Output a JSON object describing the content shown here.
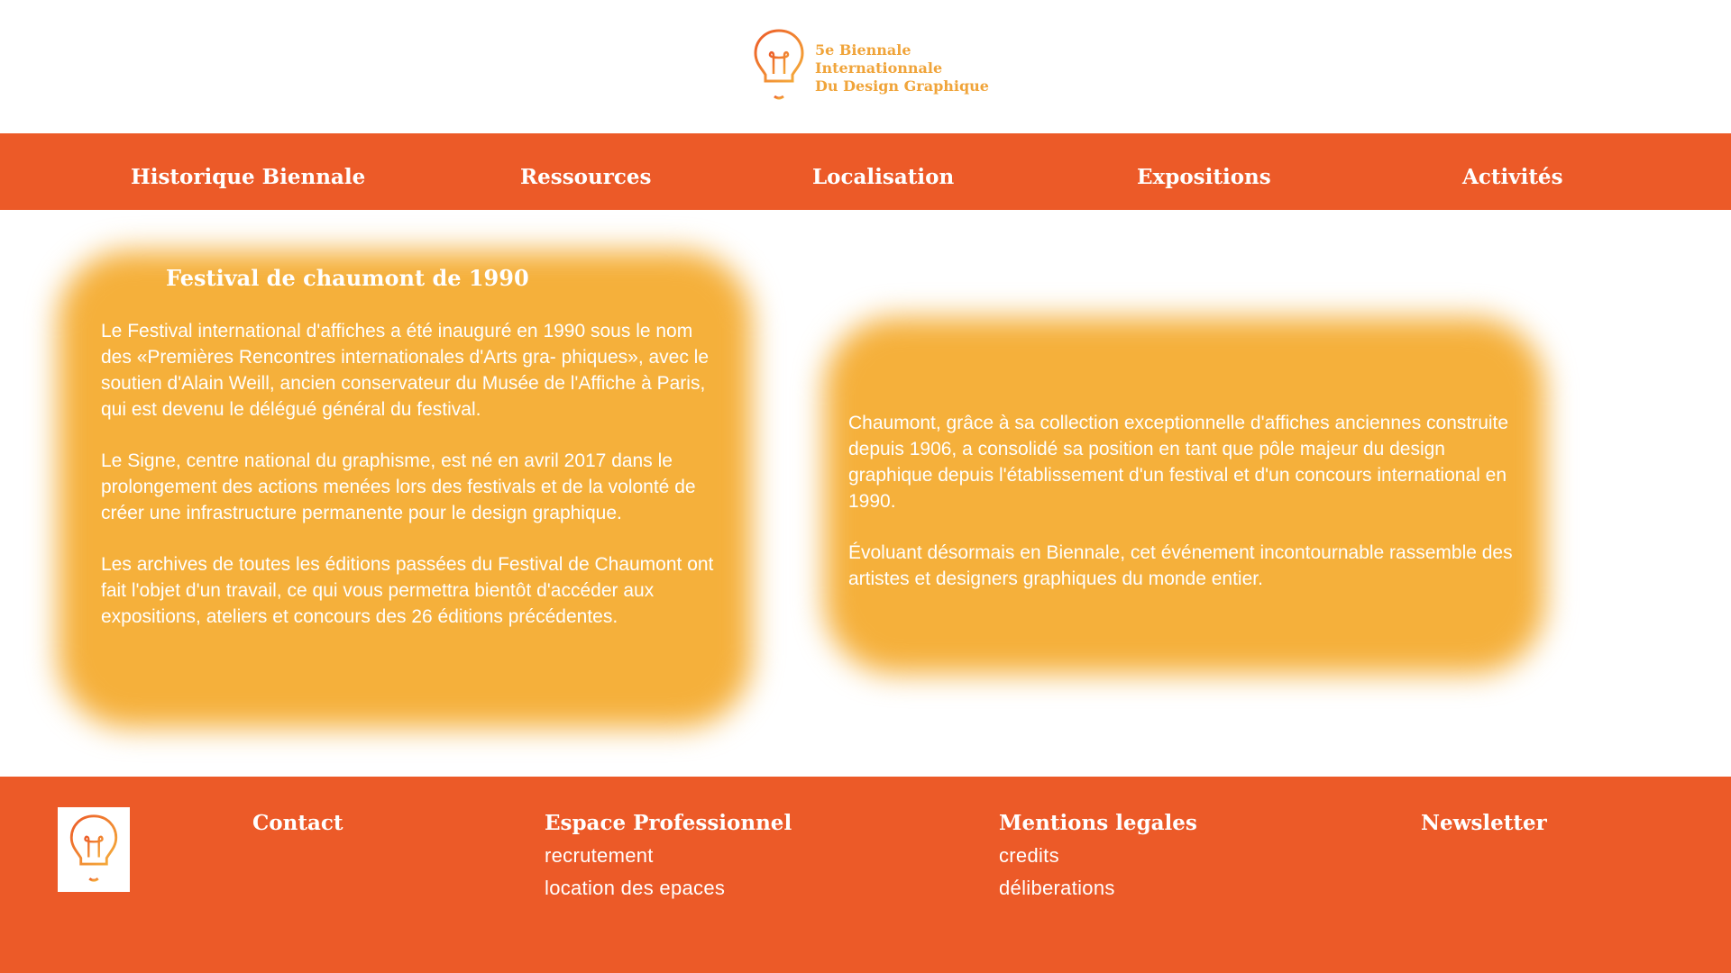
{
  "header": {
    "logo_lines": [
      "5e Biennale",
      "Internationnale",
      "Du Design Graphique"
    ],
    "logo_icon": "lightbulb-icon"
  },
  "nav": {
    "items": [
      {
        "label": "Historique Biennale"
      },
      {
        "label": "Ressources"
      },
      {
        "label": "Localisation"
      },
      {
        "label": "Expositions"
      },
      {
        "label": "Activités"
      }
    ]
  },
  "main": {
    "left_card": {
      "title": "Festival de chaumont de 1990",
      "paragraphs": [
        "Le Festival international d'affiches a été inauguré en 1990 sous le nom des «Premières Rencontres internationales d'Arts gra- phiques», avec le soutien d'Alain Weill, ancien conservateur du Musée de l'Affiche à Paris, qui est devenu le délégué général du festival.",
        "Le Signe, centre national du graphisme, est né en avril 2017 dans le prolongement des actions menées lors des festivals et de la volonté de créer une infrastructure permanente pour le design graphique.",
        "Les archives de toutes les éditions passées du Festival de Chaumont ont fait l'objet d'un travail, ce qui vous permettra bientôt d'accéder aux expositions, ateliers et concours des 26 éditions précédentes."
      ]
    },
    "right_card": {
      "paragraphs": [
        "Chaumont, grâce à sa collection exceptionnelle d'affiches anciennes construite depuis 1906, a consolidé sa position en tant que pôle majeur du design graphique depuis l'établissement d'un festival et d'un concours international en 1990.",
        "Évoluant désormais en Biennale, cet événement incontournable rassemble des artistes et designers graphiques du monde entier."
      ]
    }
  },
  "footer": {
    "logo_icon": "lightbulb-icon",
    "columns": [
      {
        "heading": "Contact",
        "links": []
      },
      {
        "heading": "Espace Professionnel",
        "links": [
          "recrutement",
          "location des epaces"
        ]
      },
      {
        "heading": "Mentions legales",
        "links": [
          "credits",
          "déliberations"
        ]
      },
      {
        "heading": "Newsletter",
        "links": []
      }
    ]
  },
  "colors": {
    "brand_orange": "#ec5a28",
    "card_orange": "#f5b03b",
    "logo_gold": "#f0a43a"
  }
}
